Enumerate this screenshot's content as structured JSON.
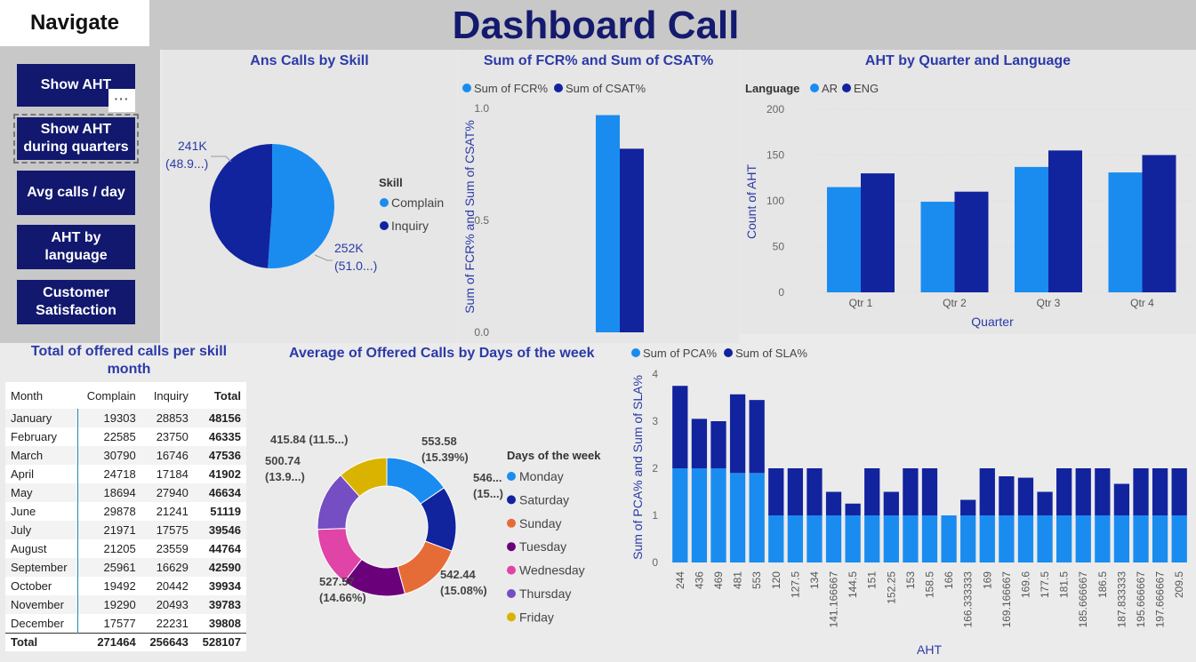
{
  "header": {
    "navigate_label": "Navigate",
    "title": "Dashboard Call"
  },
  "nav": {
    "buttons": [
      {
        "label": "Show AHT"
      },
      {
        "label": "Show AHT\nduring quarters"
      },
      {
        "label": "Avg calls / day"
      },
      {
        "label": "AHT by\nlanguage"
      },
      {
        "label": "Customer\nSatisfaction"
      }
    ],
    "more_label": "···"
  },
  "colors": {
    "light": "#1a8cf0",
    "dark": "#12239e",
    "title": "#2b3aa8",
    "nav": "#11186e"
  },
  "charts": {
    "skill_pie": {
      "title": "Ans Calls by Skill",
      "legend_title": "Skill",
      "labels": [
        "241K\n(48.9...)",
        "252K\n(51.0...)"
      ],
      "chart_data": {
        "type": "pie",
        "categories": [
          "Complain",
          "Inquiry"
        ],
        "values": [
          252000,
          241000
        ],
        "legend_placement": "right"
      }
    },
    "fcr_csat": {
      "title": "Sum of FCR% and Sum of CSAT%",
      "ylabel": "Sum of FCR% and Sum of CSAT%",
      "chart_data": {
        "type": "bar",
        "categories": [
          ""
        ],
        "series": [
          {
            "name": "Sum of FCR%",
            "values": [
              0.97
            ]
          },
          {
            "name": "Sum of CSAT%",
            "values": [
              0.82
            ]
          }
        ],
        "yticks": [
          "0.0",
          "0.5",
          "1.0"
        ],
        "ylim": [
          0,
          1.0
        ]
      }
    },
    "aht_lang": {
      "title": "AHT by Quarter and Language",
      "legend_title": "Language",
      "xlabel": "Quarter",
      "ylabel": "Count of AHT",
      "chart_data": {
        "type": "bar",
        "categories": [
          "Qtr 1",
          "Qtr 2",
          "Qtr 3",
          "Qtr 4"
        ],
        "series": [
          {
            "name": "AR",
            "values": [
              115,
              99,
              137,
              131
            ]
          },
          {
            "name": "ENG",
            "values": [
              130,
              110,
              155,
              150
            ]
          }
        ],
        "yticks": [
          "0",
          "50",
          "100",
          "150",
          "200"
        ],
        "ylim": [
          0,
          200
        ]
      }
    },
    "days_donut": {
      "title": "Average of Offered Calls by Days of the week",
      "legend_title": "Days of the week",
      "labels": [
        {
          "text": "553.58\n(15.39%)"
        },
        {
          "text": "546...\n(15...)"
        },
        {
          "text": "542.44\n(15.08%)"
        },
        {
          "text": "527.57\n(14.66%)"
        },
        {
          "text": "500.74\n(13.9...)"
        },
        {
          "text": "415.84 (11.5...)"
        }
      ],
      "chart_data": {
        "type": "pie",
        "categories": [
          "Monday",
          "Saturday",
          "Sunday",
          "Tuesday",
          "Wednesday",
          "Thursday",
          "Friday"
        ],
        "values": [
          553.58,
          546,
          542.44,
          527.57,
          500,
          500.74,
          415.84
        ],
        "colors": [
          "#1a8cf0",
          "#12239e",
          "#e66c37",
          "#6b007b",
          "#e044a7",
          "#744ec2",
          "#d9b300"
        ]
      }
    },
    "pca_sla": {
      "xlabel": "AHT",
      "ylabel": "Sum of PCA% and Sum of SLA%",
      "chart_data": {
        "type": "bar",
        "stacked": true,
        "categories": [
          "244",
          "436",
          "469",
          "481",
          "553",
          "120",
          "127.5",
          "134",
          "141.166667",
          "144.5",
          "151",
          "152.25",
          "153",
          "158.5",
          "166",
          "166.333333",
          "169",
          "169.166667",
          "169.6",
          "177.5",
          "181.5",
          "185.666667",
          "186.5",
          "187.833333",
          "195.666667",
          "197.666667",
          "209.5"
        ],
        "series": [
          {
            "name": "Sum of PCA%",
            "values": [
              2,
              2,
              2,
              1.9,
              1.9,
              1,
              1,
              1,
              1,
              1,
              1,
              1,
              1,
              1,
              1,
              1,
              1,
              1,
              1,
              1,
              1,
              1,
              1,
              1,
              1,
              1,
              1
            ]
          },
          {
            "name": "Sum of SLA%",
            "values": [
              1.75,
              1.05,
              1,
              1.67,
              1.55,
              1,
              1,
              1,
              0.5,
              0.25,
              1,
              0.5,
              1,
              1,
              0,
              0.33,
              1,
              0.83,
              0.8,
              0.5,
              1,
              1,
              1,
              0.67,
              1,
              1,
              1
            ]
          }
        ],
        "yticks": [
          "0",
          "1",
          "2",
          "3",
          "4"
        ],
        "ylim": [
          0,
          4
        ]
      }
    }
  },
  "table": {
    "title": "Total of offered calls per skill month",
    "headers": [
      "Month",
      "Complain",
      "Inquiry",
      "Total"
    ],
    "rows": [
      [
        "January",
        "19303",
        "28853",
        "48156"
      ],
      [
        "February",
        "22585",
        "23750",
        "46335"
      ],
      [
        "March",
        "30790",
        "16746",
        "47536"
      ],
      [
        "April",
        "24718",
        "17184",
        "41902"
      ],
      [
        "May",
        "18694",
        "27940",
        "46634"
      ],
      [
        "June",
        "29878",
        "21241",
        "51119"
      ],
      [
        "July",
        "21971",
        "17575",
        "39546"
      ],
      [
        "August",
        "21205",
        "23559",
        "44764"
      ],
      [
        "September",
        "25961",
        "16629",
        "42590"
      ],
      [
        "October",
        "19492",
        "20442",
        "39934"
      ],
      [
        "November",
        "19290",
        "20493",
        "39783"
      ],
      [
        "December",
        "17577",
        "22231",
        "39808"
      ]
    ],
    "total": [
      "Total",
      "271464",
      "256643",
      "528107"
    ]
  }
}
